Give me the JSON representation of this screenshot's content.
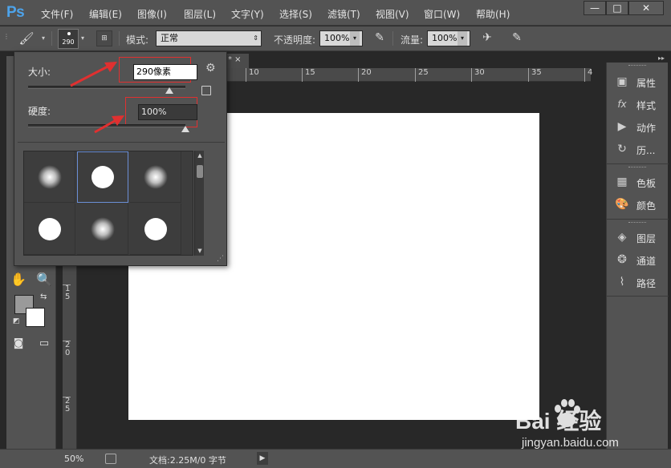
{
  "app": {
    "logo": "Ps"
  },
  "menu": [
    "文件(F)",
    "编辑(E)",
    "图像(I)",
    "图层(L)",
    "文字(Y)",
    "选择(S)",
    "滤镜(T)",
    "视图(V)",
    "窗口(W)",
    "帮助(H)"
  ],
  "window_controls": {
    "minimize": "—",
    "maximize": "□",
    "close": "✕"
  },
  "options_bar": {
    "brush_size_preview": "290",
    "mode_label": "模式:",
    "mode_value": "正常",
    "opacity_label": "不透明度:",
    "opacity_value": "100%",
    "flow_label": "流量:",
    "flow_value": "100%"
  },
  "doc_tab": {
    "label": "* ×"
  },
  "ruler_top": [
    "10",
    "15",
    "20",
    "25",
    "30",
    "35",
    "4"
  ],
  "ruler_left": [
    "1 5",
    "2 0",
    "2 5"
  ],
  "brush_popup": {
    "size_label": "大小:",
    "size_value": "290像素",
    "hardness_label": "硬度:",
    "hardness_value": "100%",
    "size_slider_level": 0.9,
    "hardness_slider_level": 1.0,
    "highlight_color": "#e03030"
  },
  "right_dock": {
    "items": [
      {
        "icon": "properties-icon",
        "label": "属性"
      },
      {
        "icon": "styles-icon",
        "label": "样式"
      },
      {
        "icon": "actions-icon",
        "label": "动作"
      },
      {
        "icon": "history-icon",
        "label": "历..."
      },
      {
        "icon": "swatches-icon",
        "label": "色板"
      },
      {
        "icon": "color-icon",
        "label": "颜色"
      },
      {
        "icon": "layers-icon",
        "label": "图层"
      },
      {
        "icon": "channels-icon",
        "label": "通道"
      },
      {
        "icon": "paths-icon",
        "label": "路径"
      }
    ]
  },
  "status_bar": {
    "zoom": "50%",
    "doc_info": "文档:2.25M/0 字节"
  },
  "watermark": {
    "brand": "Bai 经验",
    "url": "jingyan.baidu.com"
  }
}
